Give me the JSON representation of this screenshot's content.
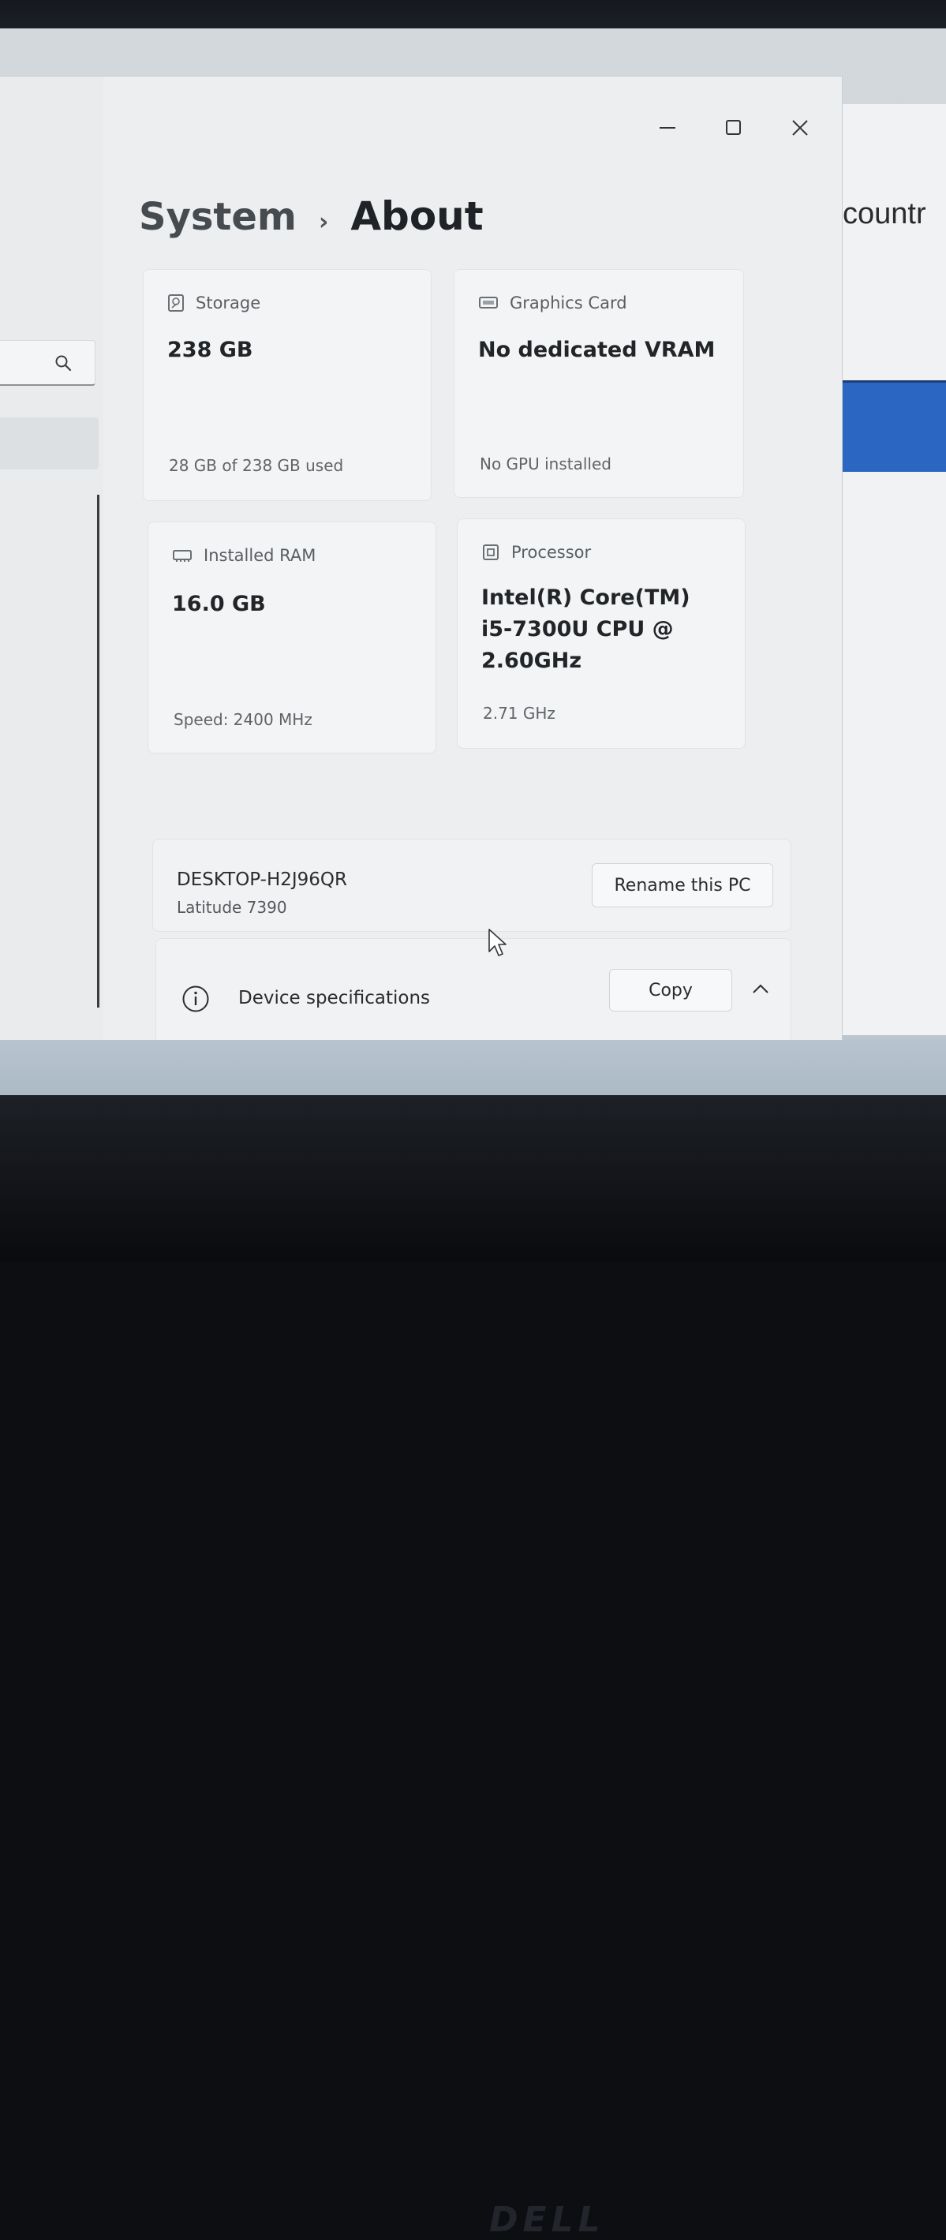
{
  "window": {
    "breadcrumb_parent": "System",
    "breadcrumb_separator": "›",
    "breadcrumb_current": "About"
  },
  "background_window": {
    "partial_text": "countr"
  },
  "cards": {
    "storage": {
      "label": "Storage",
      "value": "238 GB",
      "detail": "28 GB of 238 GB used",
      "icon": "storage-drive-icon"
    },
    "graphics": {
      "label": "Graphics Card",
      "value": "No dedicated VRAM",
      "detail": "No GPU installed",
      "icon": "display-adapter-icon"
    },
    "ram": {
      "label": "Installed RAM",
      "value": "16.0 GB",
      "detail": "Speed: 2400 MHz",
      "icon": "memory-module-icon"
    },
    "processor": {
      "label": "Processor",
      "value_line1": "Intel(R) Core(TM)",
      "value_line2": "i5-7300U CPU @",
      "value_line3": "2.60GHz",
      "detail": "2.71 GHz",
      "icon": "processor-chip-icon"
    }
  },
  "device": {
    "name": "DESKTOP-H2J96QR",
    "model": "Latitude 7390",
    "rename_button": "Rename this PC"
  },
  "specs": {
    "label": "Device specifications",
    "copy_button": "Copy"
  },
  "colors": {
    "accent": "#2b66c2",
    "window_bg": "#eceeef",
    "card_bg": "#f3f4f5"
  }
}
